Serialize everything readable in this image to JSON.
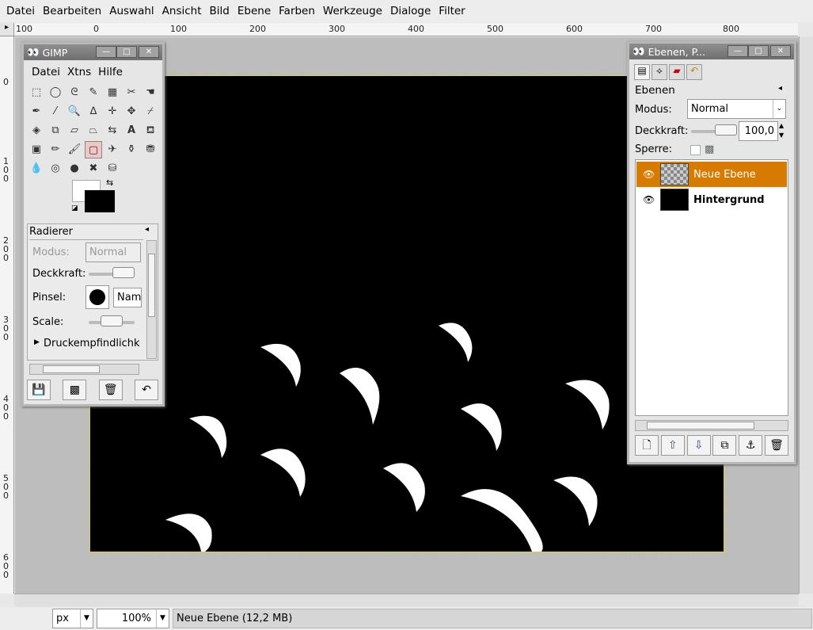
{
  "menu": [
    "Datei",
    "Bearbeiten",
    "Auswahl",
    "Ansicht",
    "Bild",
    "Ebene",
    "Farben",
    "Werkzeuge",
    "Dialoge",
    "Filter"
  ],
  "ruler": {
    "h_labels": [
      "100",
      "0",
      "100",
      "200",
      "300",
      "400",
      "500",
      "600",
      "700",
      "800"
    ],
    "v_labels": [
      "0",
      "1\n0\n0",
      "2\n0\n0",
      "3\n0\n0",
      "4\n0\n0",
      "5\n0\n0",
      "6\n0\n0"
    ]
  },
  "toolbox": {
    "title": "GIMP",
    "menu": [
      "Datei",
      "Xtns",
      "Hilfe"
    ],
    "tool_options": {
      "title": "Radierer",
      "mode_label": "Modus:",
      "mode_value": "Normal",
      "opacity_label": "Deckkraft:",
      "brush_label": "Pinsel:",
      "brush_name": "Nam",
      "scale_label": "Scale:",
      "pressure_label": "Druckempfindlichke"
    }
  },
  "layers": {
    "title": "Ebenen, P...",
    "header": "Ebenen",
    "mode_label": "Modus:",
    "mode_value": "Normal",
    "opacity_label": "Deckkraft:",
    "opacity_value": "100,0",
    "lock_label": "Sperre:",
    "items": [
      {
        "name": "Neue Ebene",
        "selected": true
      },
      {
        "name": "Hintergrund",
        "selected": false
      }
    ]
  },
  "status": {
    "unit": "px",
    "zoom": "100%",
    "message": "Neue Ebene (12,2 MB)"
  },
  "colors": {
    "selection": "#d77a00",
    "canvas": "#000000"
  }
}
